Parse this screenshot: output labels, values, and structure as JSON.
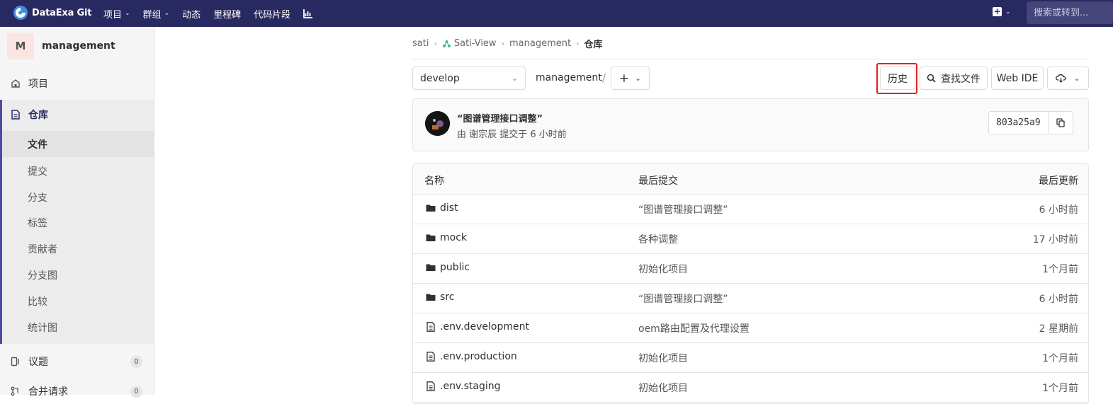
{
  "topbar": {
    "brand": "DataExa Git",
    "nav": [
      {
        "label": "项目",
        "has_dropdown": true
      },
      {
        "label": "群组",
        "has_dropdown": true
      },
      {
        "label": "动态",
        "has_dropdown": false
      },
      {
        "label": "里程碑",
        "has_dropdown": false
      },
      {
        "label": "代码片段",
        "has_dropdown": false
      }
    ],
    "chart_icon": "chart-icon",
    "plus_icon": "plus-square-icon",
    "search_placeholder": "搜索或转到...",
    "colors": {
      "bar": "#292961",
      "accent": "#4b4ba3"
    }
  },
  "sidebar": {
    "avatar_letter": "M",
    "project_name": "management",
    "items": [
      {
        "label": "项目",
        "icon": "home-icon"
      },
      {
        "label": "仓库",
        "icon": "document-icon"
      }
    ],
    "repo_subitems": [
      "文件",
      "提交",
      "分支",
      "标签",
      "贡献者",
      "分支图",
      "比较",
      "统计图"
    ],
    "active_subitem": "文件",
    "issues": {
      "label": "议题",
      "count": "0",
      "icon": "issues-icon"
    },
    "merge": {
      "label": "合并请求",
      "count": "0",
      "icon": "merge-request-icon"
    }
  },
  "breadcrumb": [
    "sati",
    "Sati-View",
    "management",
    "仓库"
  ],
  "toolbar": {
    "branch": "develop",
    "path": "management",
    "path_sep": "/",
    "add_label": "+",
    "history_label": "历史",
    "find_label": "查找文件",
    "webide_label": "Web IDE",
    "highlight_color": "#e32222"
  },
  "commit": {
    "title": "“图谱管理接口调整”",
    "subtitle": "由 谢宗辰 提交于 6 小时前",
    "sha": "803a25a9"
  },
  "files": {
    "headers": {
      "name": "名称",
      "last_commit": "最后提交",
      "last_update": "最后更新"
    },
    "rows": [
      {
        "name": "dist",
        "type": "folder",
        "message": "“图谱管理接口调整”",
        "time": "6 小时前"
      },
      {
        "name": "mock",
        "type": "folder",
        "message": "各种调整",
        "time": "17 小时前"
      },
      {
        "name": "public",
        "type": "folder",
        "message": "初始化项目",
        "time": "1个月前"
      },
      {
        "name": "src",
        "type": "folder",
        "message": "“图谱管理接口调整”",
        "time": "6 小时前"
      },
      {
        "name": ".env.development",
        "type": "file",
        "message": "oem路由配置及代理设置",
        "time": "2 星期前"
      },
      {
        "name": ".env.production",
        "type": "file",
        "message": "初始化项目",
        "time": "1个月前"
      },
      {
        "name": ".env.staging",
        "type": "file",
        "message": "初始化项目",
        "time": "1个月前"
      }
    ]
  }
}
